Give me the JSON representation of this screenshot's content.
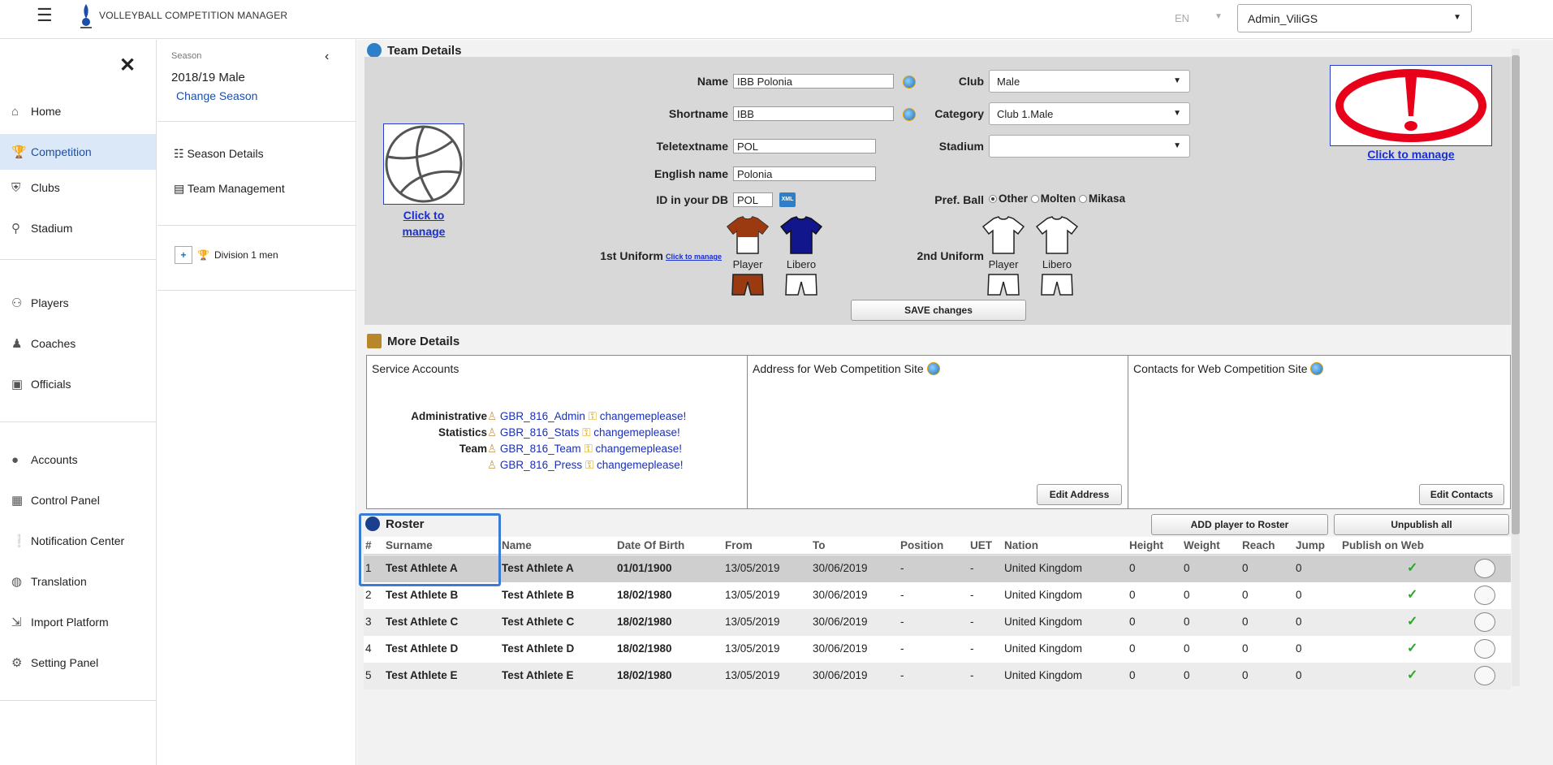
{
  "app": {
    "title": "VOLLEYBALL COMPETITION MANAGER",
    "lang": "EN",
    "user": "Admin_ViliGS"
  },
  "nav": {
    "items": [
      {
        "label": "Home",
        "icon": "home-icon"
      },
      {
        "label": "Competition",
        "icon": "trophy-icon"
      },
      {
        "label": "Clubs",
        "icon": "shield-icon"
      },
      {
        "label": "Stadium",
        "icon": "map-pin-icon"
      },
      {
        "label": "Players",
        "icon": "players-icon"
      },
      {
        "label": "Coaches",
        "icon": "coach-icon"
      },
      {
        "label": "Officials",
        "icon": "badge-icon"
      },
      {
        "label": "Accounts",
        "icon": "account-icon"
      },
      {
        "label": "Control Panel",
        "icon": "calendar-icon"
      },
      {
        "label": "Notification Center",
        "icon": "notification-icon"
      },
      {
        "label": "Translation",
        "icon": "globe-icon"
      },
      {
        "label": "Import Platform",
        "icon": "import-icon"
      },
      {
        "label": "Setting Panel",
        "icon": "gear-icon"
      }
    ]
  },
  "season": {
    "label": "Season",
    "value": "2018/19 Male",
    "change": "Change Season",
    "links": [
      "Season Details",
      "Team Management"
    ],
    "division": "Division 1 men"
  },
  "team": {
    "heading": "Team Details",
    "labels": {
      "name": "Name",
      "shortname": "Shortname",
      "teletext": "Teletextname",
      "english": "English name",
      "iddb": "ID in your DB",
      "club": "Club",
      "category": "Category",
      "stadium": "Stadium",
      "prefball": "Pref. Ball",
      "uniform1": "1st Uniform",
      "uniform2": "2nd Uniform",
      "clickmanage_small": "Click to manage",
      "player": "Player",
      "libero": "Libero"
    },
    "values": {
      "name": "IBB Polonia",
      "shortname": "IBB",
      "teletext": "POL",
      "english": "Polonia",
      "iddb": "POL",
      "club": "Male",
      "category": "Club 1.Male",
      "stadium": ""
    },
    "balls": [
      "Other",
      "Molten",
      "Mikasa"
    ],
    "selected_ball": "Other",
    "click_to_manage": "Click to manage",
    "click_to_manage_logo_1": "Click to",
    "click_to_manage_logo_2": "manage",
    "save": "SAVE changes",
    "xml_badge": "XML"
  },
  "more": {
    "heading": "More Details",
    "service_accounts": "Service Accounts",
    "address_title": "Address for Web Competition Site",
    "contacts_title": "Contacts for Web Competition Site",
    "edit_address": "Edit Address",
    "edit_contacts": "Edit Contacts",
    "accounts": [
      {
        "role": "Administrative",
        "user": "GBR_816_Admin",
        "password": "changemeplease!"
      },
      {
        "role": "Statistics",
        "user": "GBR_816_Stats",
        "password": "changemeplease!"
      },
      {
        "role": "Team",
        "user": "GBR_816_Team",
        "password": "changemeplease!"
      },
      {
        "role": "",
        "user": "GBR_816_Press",
        "password": "changemeplease!"
      }
    ]
  },
  "roster": {
    "heading": "Roster",
    "add": "ADD player to Roster",
    "unpublish": "Unpublish all",
    "columns": [
      "#",
      "Surname",
      "Name",
      "Date Of Birth",
      "From",
      "To",
      "Position",
      "UET",
      "Nation",
      "Height",
      "Weight",
      "Reach",
      "Jump",
      "Publish on Web"
    ],
    "rows": [
      [
        "1",
        "Test Athlete A",
        "Test Athlete A",
        "01/01/1900",
        "13/05/2019",
        "30/06/2019",
        "-",
        "-",
        "United Kingdom",
        "0",
        "0",
        "0",
        "0"
      ],
      [
        "2",
        "Test Athlete B",
        "Test Athlete B",
        "18/02/1980",
        "13/05/2019",
        "30/06/2019",
        "-",
        "-",
        "United Kingdom",
        "0",
        "0",
        "0",
        "0"
      ],
      [
        "3",
        "Test Athlete C",
        "Test Athlete C",
        "18/02/1980",
        "13/05/2019",
        "30/06/2019",
        "-",
        "-",
        "United Kingdom",
        "0",
        "0",
        "0",
        "0"
      ],
      [
        "4",
        "Test Athlete D",
        "Test Athlete D",
        "18/02/1980",
        "13/05/2019",
        "30/06/2019",
        "-",
        "-",
        "United Kingdom",
        "0",
        "0",
        "0",
        "0"
      ],
      [
        "5",
        "Test Athlete E",
        "Test Athlete E",
        "18/02/1980",
        "13/05/2019",
        "30/06/2019",
        "-",
        "-",
        "United Kingdom",
        "0",
        "0",
        "0",
        "0"
      ]
    ]
  },
  "colors": {
    "accent": "#1a4fa8",
    "uniform_home": "#9b3a10",
    "uniform_libero": "#12168c",
    "alert": "#e8001a"
  }
}
